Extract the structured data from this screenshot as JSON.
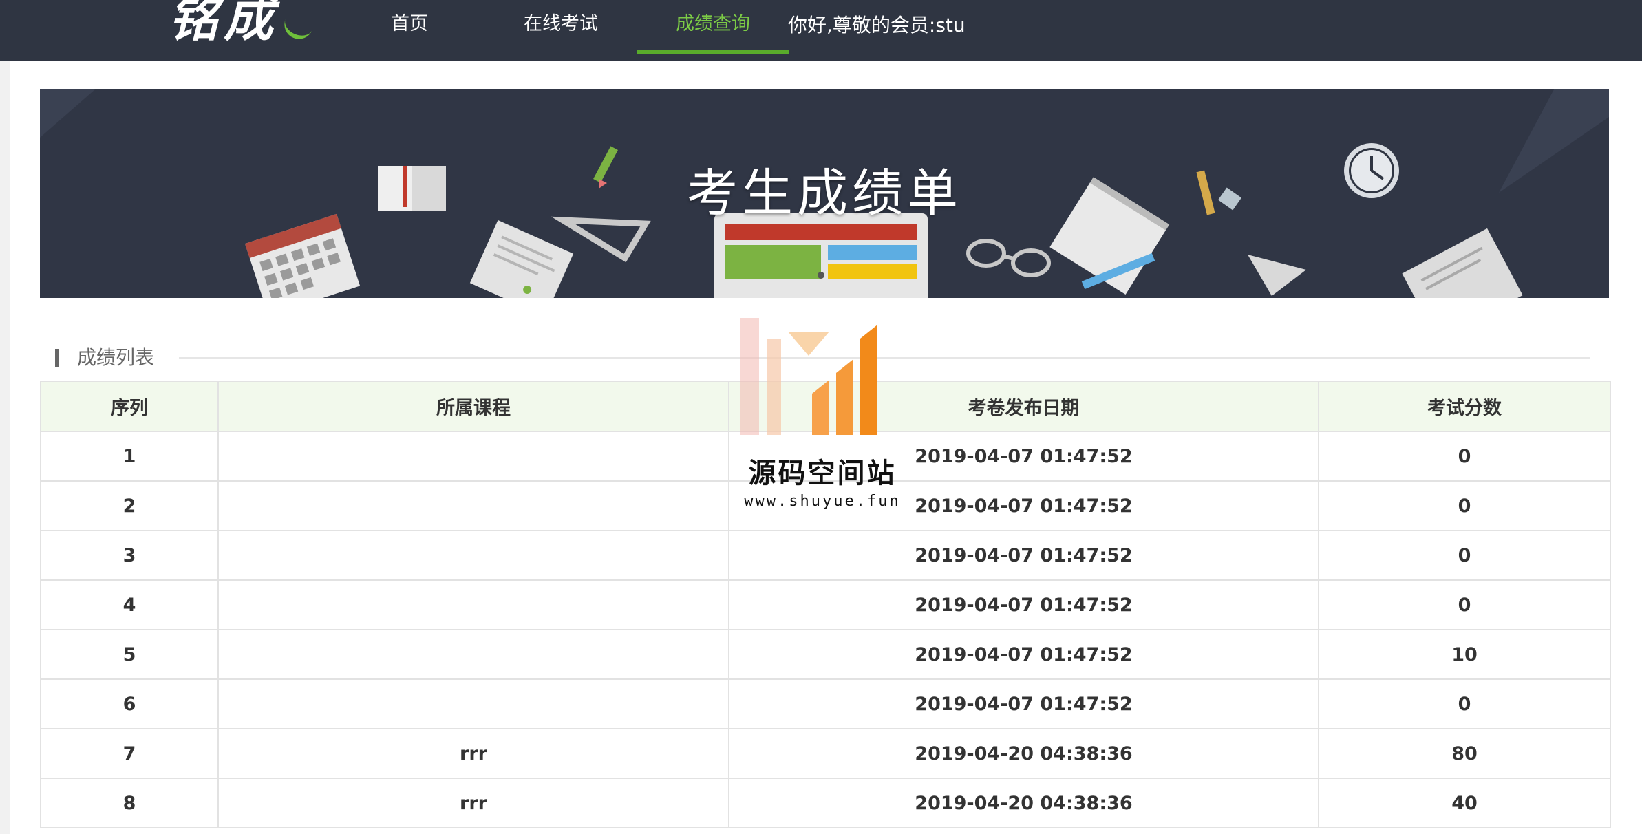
{
  "colors": {
    "nav_bg": "#2f3542",
    "nav_active": "#7ccb46",
    "banner_bg": "#303645",
    "table_header_bg": "#f2f9ec",
    "watermark_orange": "#f28a1a"
  },
  "nav": {
    "logo_text": "铭成",
    "items": [
      {
        "label": "首页",
        "active": false
      },
      {
        "label": "在线考试",
        "active": false
      },
      {
        "label": "成绩查询",
        "active": true
      }
    ],
    "greeting": "你好,尊敬的会员:stu"
  },
  "banner": {
    "title": "考生成绩单",
    "icons": [
      "book-icon",
      "pencil-icon",
      "calendar-icon",
      "document-icon",
      "ruler-triangle-icon",
      "monitor-icon",
      "glasses-icon",
      "notebook-icon",
      "pen-icon",
      "clock-icon",
      "paper-plane-icon",
      "paper-stack-icon"
    ]
  },
  "section": {
    "title": "成绩列表"
  },
  "table": {
    "headers": [
      "序列",
      "所属课程",
      "考卷发布日期",
      "考试分数"
    ],
    "rows": [
      [
        "1",
        "",
        "2019-04-07 01:47:52",
        "0"
      ],
      [
        "2",
        "",
        "2019-04-07 01:47:52",
        "0"
      ],
      [
        "3",
        "",
        "2019-04-07 01:47:52",
        "0"
      ],
      [
        "4",
        "",
        "2019-04-07 01:47:52",
        "0"
      ],
      [
        "5",
        "",
        "2019-04-07 01:47:52",
        "10"
      ],
      [
        "6",
        "",
        "2019-04-07 01:47:52",
        "0"
      ],
      [
        "7",
        "rrr",
        "2019-04-20 04:38:36",
        "80"
      ],
      [
        "8",
        "rrr",
        "2019-04-20 04:38:36",
        "40"
      ]
    ]
  },
  "watermark": {
    "text": "源码空间站",
    "url": "www.shuyue.fun"
  }
}
